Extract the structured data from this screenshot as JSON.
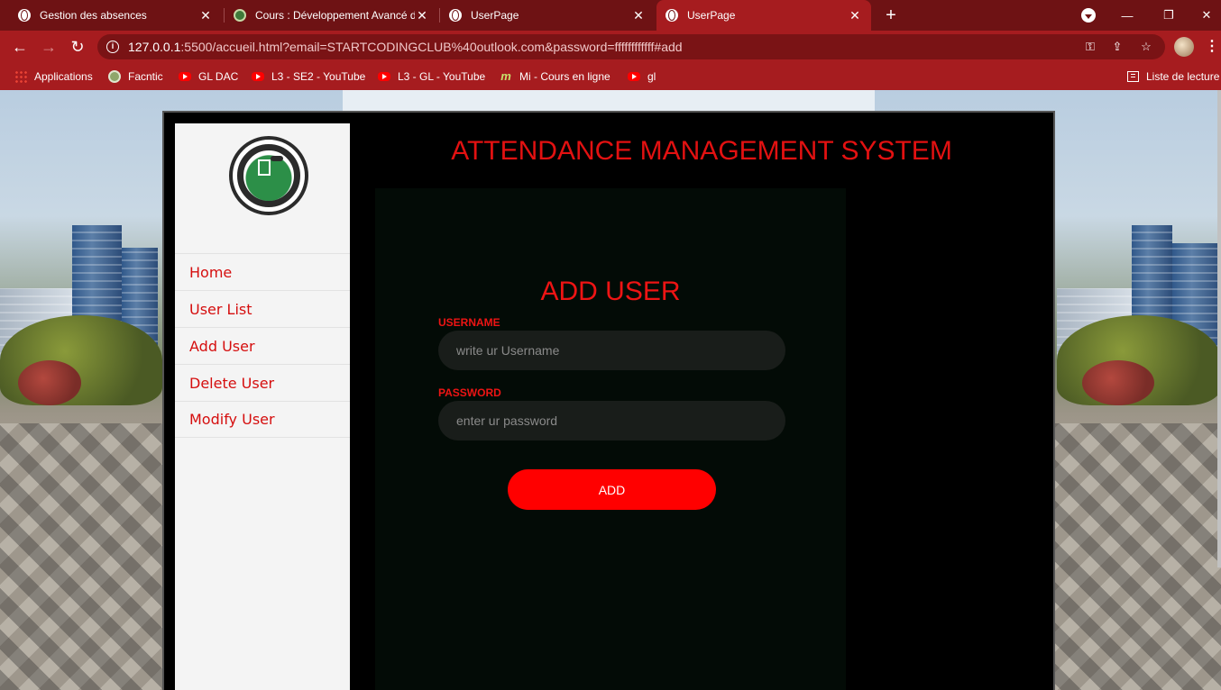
{
  "browser": {
    "tabs": [
      {
        "title": "Gestion des absences",
        "icon": "globe-icon",
        "active": false
      },
      {
        "title": "Cours : Développement Avancé d",
        "icon": "moodle-icon",
        "active": false
      },
      {
        "title": "UserPage",
        "icon": "globe-icon",
        "active": false
      },
      {
        "title": "UserPage",
        "icon": "globe-icon",
        "active": true
      }
    ],
    "new_tab_label": "+",
    "window_controls": {
      "minimize": "—",
      "restore": "❐",
      "close": "✕"
    },
    "address": {
      "host": "127.0.0.1",
      "rest": ":5500/accueil.html?email=STARTCODINGCLUB%40outlook.com&password=ffffffffffff#add"
    },
    "bookmarks": [
      {
        "label": "Applications",
        "icon": "apps-icon"
      },
      {
        "label": "Facntic",
        "icon": "facntic-icon"
      },
      {
        "label": "GL DAC",
        "icon": "youtube-icon"
      },
      {
        "label": "L3 - SE2 - YouTube",
        "icon": "youtube-icon"
      },
      {
        "label": "L3 - GL - YouTube",
        "icon": "youtube-icon"
      },
      {
        "label": "Mi - Cours en ligne",
        "icon": "mi-icon"
      },
      {
        "label": "gl",
        "icon": "youtube-icon"
      }
    ],
    "reading_list_label": "Liste de lecture"
  },
  "app": {
    "title": "ATTENDANCE MANAGEMENT SYSTEM",
    "sidebar": {
      "items": [
        {
          "label": "Home"
        },
        {
          "label": "User List"
        },
        {
          "label": "Add User"
        },
        {
          "label": "Delete User"
        },
        {
          "label": "Modify User"
        }
      ]
    },
    "form": {
      "title": "ADD USER",
      "username_label": "USERNAME",
      "username_placeholder": "write ur Username",
      "password_label": "PASSWORD",
      "password_placeholder": "enter ur password",
      "submit_label": "ADD"
    }
  },
  "colors": {
    "browser_frame": "#a61c1f",
    "tab_strip": "#6e1214",
    "accent_red": "#ff0000",
    "sidebar_bg": "#f4f4f4",
    "panel_bg": "#000000"
  }
}
